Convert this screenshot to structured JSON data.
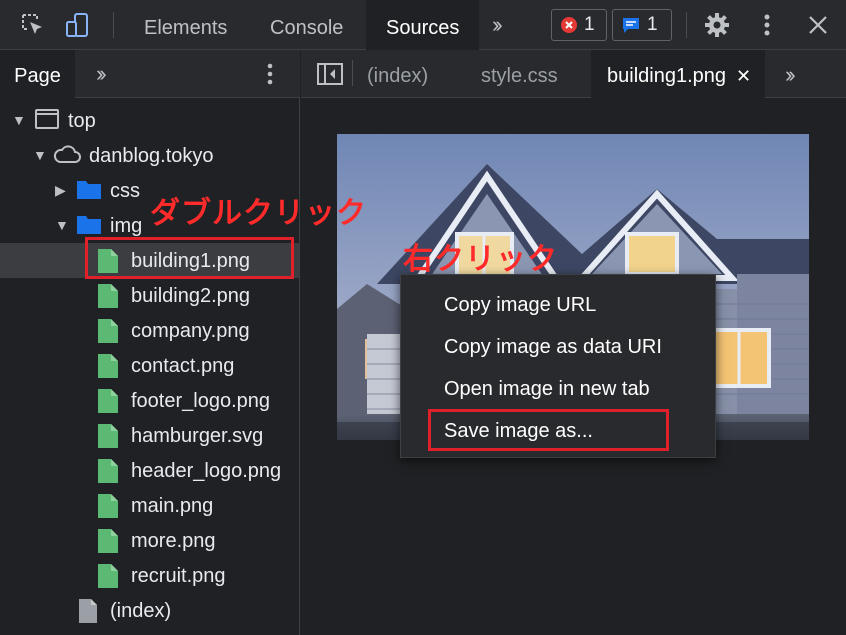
{
  "toolbar": {
    "tabs": {
      "elements": "Elements",
      "console": "Console",
      "sources": "Sources"
    },
    "error_count": "1",
    "message_count": "1",
    "icons": [
      "inspect-icon",
      "device-toggle-icon",
      "more-tabs-icon",
      "error-icon",
      "message-icon",
      "gear-icon",
      "kebab-menu-icon",
      "close-icon"
    ]
  },
  "navigator": {
    "page_tab": "Page",
    "tree": {
      "top": "top",
      "domain": "danblog.tokyo",
      "css": "css",
      "img": "img",
      "files": [
        "building1.png",
        "building2.png",
        "company.png",
        "contact.png",
        "footer_logo.png",
        "hamburger.svg",
        "header_logo.png",
        "main.png",
        "more.png",
        "recruit.png"
      ],
      "index": "(index)"
    }
  },
  "editor": {
    "tabs": {
      "index": "(index)",
      "style": "style.css",
      "building": "building1.png"
    },
    "close_symbol": "✕"
  },
  "context_menu": {
    "items": [
      "Copy image URL",
      "Copy image as data URI",
      "Open image in new tab",
      "Save image as..."
    ]
  },
  "annotations": {
    "double_click": "ダブルクリック",
    "right_click": "右クリック"
  },
  "colors": {
    "background": "#202124",
    "toolbar": "#292a2d",
    "highlight_red": "#e0202a",
    "folder_blue": "#1a73e8",
    "file_green": "#5bb974",
    "error_red": "#e53935",
    "message_blue": "#1a73e8"
  }
}
